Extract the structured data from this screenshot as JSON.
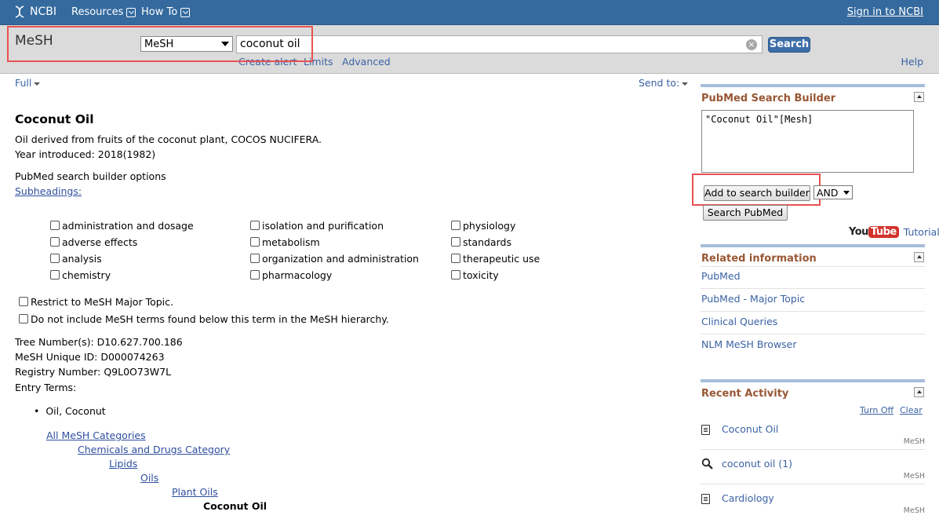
{
  "topbar": {
    "logo": "NCBI",
    "resources": "Resources",
    "howto": "How To",
    "signin": "Sign in to NCBI"
  },
  "searchbar": {
    "db_title": "MeSH",
    "db_selected": "MeSH",
    "query": "coconut oil",
    "search_label": "Search",
    "create_alert": "Create alert",
    "limits": "Limits",
    "advanced": "Advanced",
    "help": "Help"
  },
  "toolbar": {
    "full": "Full",
    "send_to": "Send to:"
  },
  "record": {
    "title": "Coconut Oil",
    "description": "Oil derived from fruits of the coconut plant, COCOS NUCIFERA.",
    "year_introduced": "Year introduced: 2018(1982)",
    "builder_options": "PubMed search builder options",
    "subheadings_label": "Subheadings:",
    "subheadings": {
      "col1": [
        "administration and dosage",
        "adverse effects",
        "analysis",
        "chemistry"
      ],
      "col2": [
        "isolation and purification",
        "metabolism",
        "organization and administration",
        "pharmacology"
      ],
      "col3": [
        "physiology",
        "standards",
        "therapeutic use",
        "toxicity"
      ]
    },
    "restrict_major": "Restrict to MeSH Major Topic.",
    "no_explode": "Do not include MeSH terms found below this term in the MeSH hierarchy.",
    "tree_number": "Tree Number(s): D10.627.700.186",
    "unique_id": "MeSH Unique ID: D000074263",
    "registry_number": "Registry Number: Q9L0O73W7L",
    "entry_terms_label": "Entry Terms:",
    "entry_terms": [
      "Oil, Coconut"
    ],
    "tree": [
      "All MeSH Categories",
      "Chemicals and Drugs Category",
      "Lipids",
      "Oils",
      "Plant Oils",
      "Coconut Oil"
    ]
  },
  "sidebar": {
    "builder": {
      "title": "PubMed Search Builder",
      "query": "\"Coconut Oil\"[Mesh]",
      "add_button": "Add to search builder",
      "operator": "AND",
      "search_pubmed": "Search PubMed",
      "youtube_you": "You",
      "youtube_tube": "Tube",
      "tutorial": "Tutorial"
    },
    "related": {
      "title": "Related information",
      "links": [
        "PubMed",
        "PubMed - Major Topic",
        "Clinical Queries",
        "NLM MeSH Browser"
      ]
    },
    "recent": {
      "title": "Recent Activity",
      "turn_off": "Turn Off",
      "clear": "Clear",
      "items": [
        {
          "label": "Coconut Oil",
          "db": "MeSH",
          "icon": "document-icon"
        },
        {
          "label": "coconut oil (1)",
          "db": "MeSH",
          "icon": "search-icon"
        },
        {
          "label": "Cardiology",
          "db": "MeSH",
          "icon": "document-icon"
        }
      ]
    }
  },
  "colors": {
    "topbar": "#346a9e",
    "link": "#3a62a4",
    "section_head": "#985735",
    "highlight": "#e85252"
  }
}
